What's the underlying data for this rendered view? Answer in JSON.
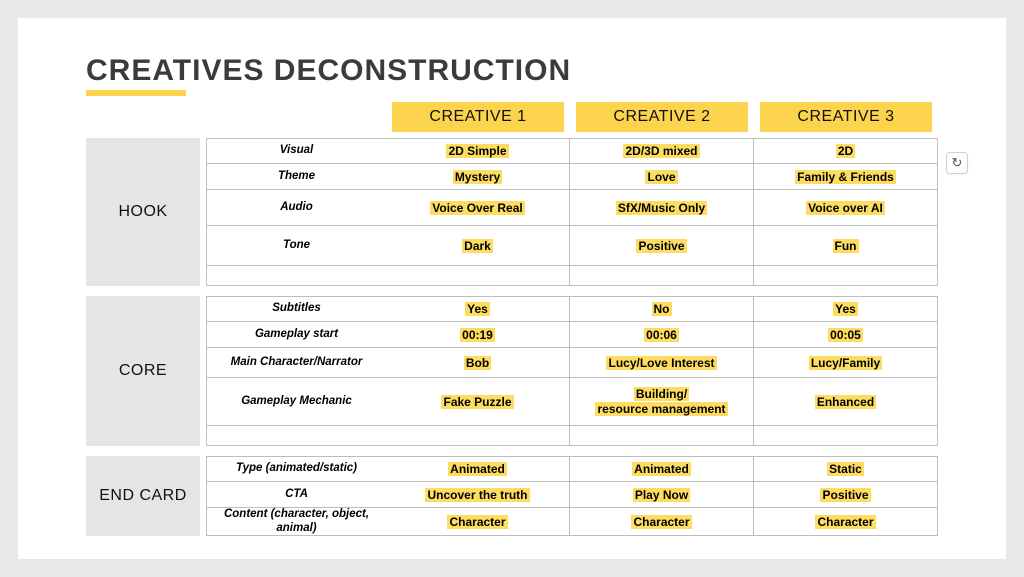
{
  "title": "CREATIVES DECONSTRUCTION",
  "columns": [
    "CREATIVE 1",
    "CREATIVE 2",
    "CREATIVE 3"
  ],
  "sections": [
    {
      "name": "HOOK",
      "rows": [
        {
          "label": "Visual",
          "c": [
            "2D Simple",
            "2D/3D mixed",
            "2D"
          ]
        },
        {
          "label": "Theme",
          "c": [
            "Mystery",
            "Love",
            "Family & Friends"
          ]
        },
        {
          "label": "Audio",
          "c": [
            "Voice Over Real",
            "SfX/Music Only",
            "Voice over AI"
          ]
        },
        {
          "label": "Tone",
          "c": [
            "Dark",
            "Positive",
            "Fun"
          ]
        }
      ]
    },
    {
      "name": "CORE",
      "rows": [
        {
          "label": "Subtitles",
          "c": [
            "Yes",
            "No",
            "Yes"
          ]
        },
        {
          "label": "Gameplay start",
          "c": [
            "00:19",
            "00:06",
            "00:05"
          ]
        },
        {
          "label": "Main Character/Narrator",
          "c": [
            "Bob",
            "Lucy/Love Interest",
            "Lucy/Family"
          ]
        },
        {
          "label": "Gameplay Mechanic",
          "c": [
            "Fake Puzzle",
            "Building/\nresource management",
            "Enhanced"
          ]
        }
      ]
    },
    {
      "name": "END CARD",
      "rows": [
        {
          "label": "Type (animated/static)",
          "c": [
            "Animated",
            "Animated",
            "Static"
          ]
        },
        {
          "label": "CTA",
          "c": [
            "Uncover the truth",
            "Play Now",
            "Positive"
          ]
        },
        {
          "label": "Content (character, object, animal)",
          "c": [
            "Character",
            "Character",
            "Character"
          ]
        }
      ]
    }
  ],
  "refresh_icon": "↻"
}
